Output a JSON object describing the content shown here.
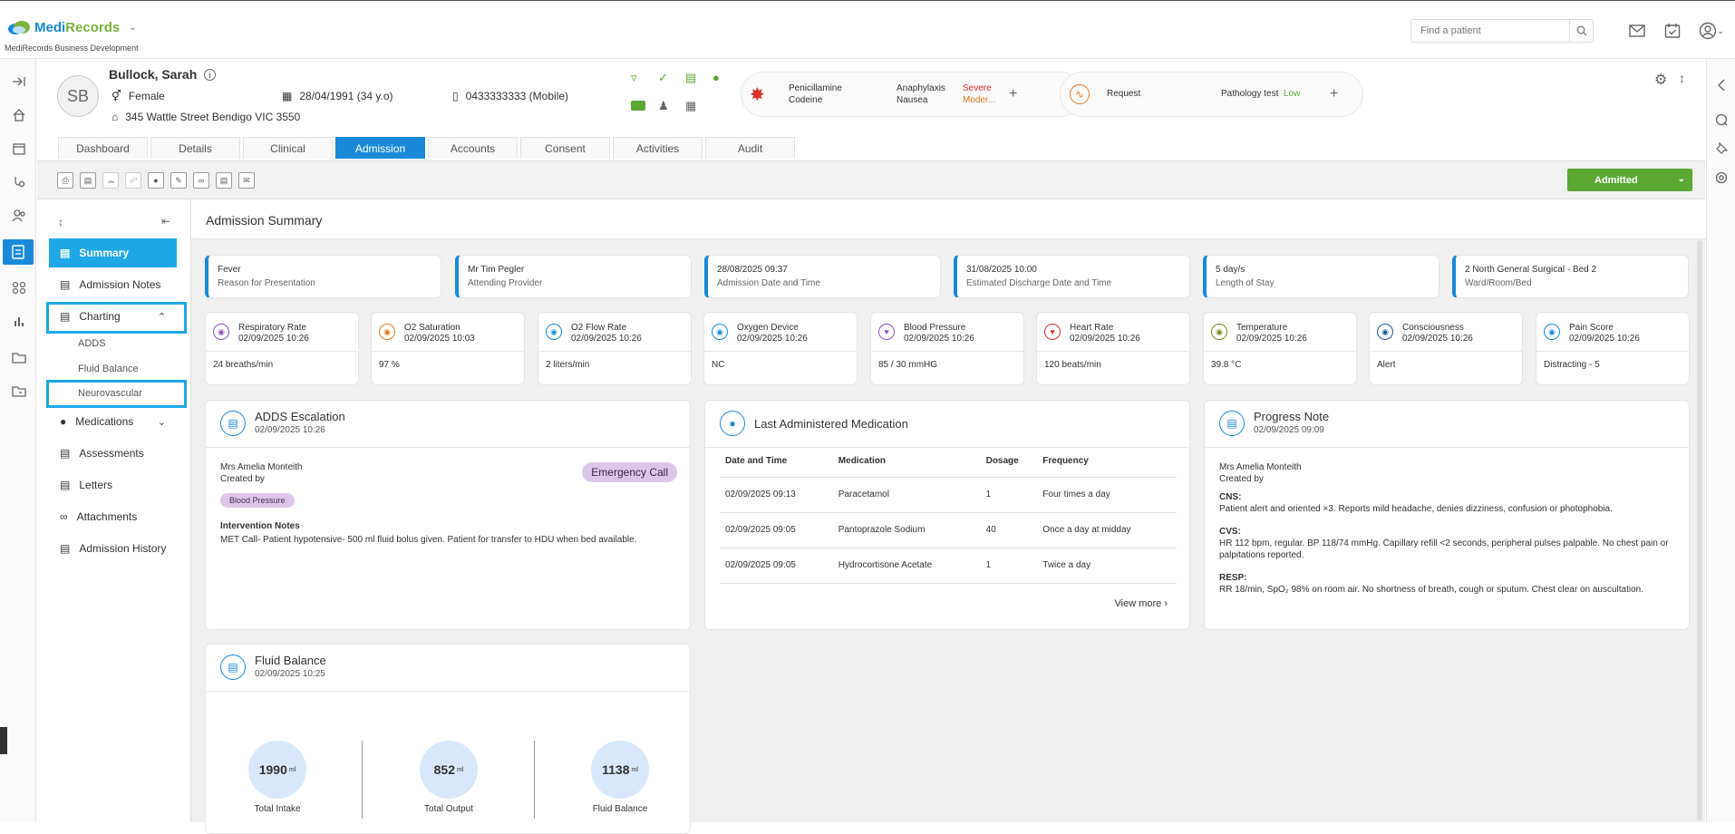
{
  "app": {
    "name_part1": "Medi",
    "name_part2": "Records",
    "subtitle": "MediRecords Business Development",
    "brand_color": "#1a8ad8",
    "accent_green": "#5aa832"
  },
  "search": {
    "placeholder": "Find a patient"
  },
  "patient": {
    "initials": "SB",
    "name": "Bullock, Sarah",
    "gender": "Female",
    "dob": "28/04/1991 (34 y.o)",
    "phone": "0433333333 (Mobile)",
    "address": "345 Wattle Street Bendigo VIC 3550"
  },
  "allergies": {
    "items": [
      "Penicillamine",
      "Codeine"
    ],
    "reactions": [
      "Anaphylaxis",
      "Nausea"
    ],
    "severity": [
      "Severe",
      "Moder..."
    ]
  },
  "request": {
    "label": "Request",
    "test": "Pathology test",
    "level": "Low"
  },
  "tabs": [
    "Dashboard",
    "Details",
    "Clinical",
    "Admission",
    "Accounts",
    "Consent",
    "Activities",
    "Audit"
  ],
  "status": {
    "label": "Admitted"
  },
  "sidenav": {
    "summary": "Summary",
    "admission_notes": "Admission Notes",
    "charting": "Charting",
    "adds": "ADDS",
    "fluid_balance": "Fluid Balance",
    "neurovascular": "Neurovascular",
    "medications": "Medications",
    "assessments": "Assessments",
    "letters": "Letters",
    "attachments": "Attachments",
    "admission_history": "Admission History"
  },
  "main": {
    "title": "Admission Summary"
  },
  "summary_cards": [
    {
      "value": "Fever",
      "label": "Reason for Presentation"
    },
    {
      "value": "Mr Tim Pegler",
      "label": "Attending Provider"
    },
    {
      "value": "28/08/2025 09:37",
      "label": "Admission Date and Time"
    },
    {
      "value": "31/08/2025 10:00",
      "label": "Estimated Discharge Date and Time"
    },
    {
      "value": "5 day/s",
      "label": "Length of Stay"
    },
    {
      "value": "2 North General Surgical - Bed 2",
      "label": "Ward/Room/Bed"
    }
  ],
  "vitals": [
    {
      "name": "Respiratory Rate",
      "time": "02/09/2025 10:26",
      "value": "24 breaths/min",
      "color": "#8a4fbd"
    },
    {
      "name": "O2 Saturation",
      "time": "02/09/2025 10:03",
      "value": "97 %",
      "color": "#e07a1f"
    },
    {
      "name": "O2 Flow Rate",
      "time": "02/09/2025 10:26",
      "value": "2 liters/min",
      "color": "#1a8ad8"
    },
    {
      "name": "Oxygen Device",
      "time": "02/09/2025 10:26",
      "value": "NC",
      "color": "#1a8ad8"
    },
    {
      "name": "Blood Pressure",
      "time": "02/09/2025 10:26",
      "value": "85 / 30 mmHG",
      "color": "#8a4fbd"
    },
    {
      "name": "Heart Rate",
      "time": "02/09/2025 10:26",
      "value": "120 beats/min",
      "color": "#d9302c"
    },
    {
      "name": "Temperature",
      "time": "02/09/2025 10:26",
      "value": "39.8 °C",
      "color": "#7a8a1a"
    },
    {
      "name": "Consciousness",
      "time": "02/09/2025 10:26",
      "value": "Alert",
      "color": "#1a5a9a"
    },
    {
      "name": "Pain Score",
      "time": "02/09/2025 10:26",
      "value": "Distracting - 5",
      "color": "#1a8ad8"
    }
  ],
  "adds": {
    "title": "ADDS Escalation",
    "time": "02/09/2025 10:26",
    "author": "Mrs Amelia Monteith",
    "created_by": "Created by",
    "badge": "Blood Pressure",
    "call": "Emergency Call",
    "notes_label": "Intervention Notes",
    "notes": "MET Call- Patient hypotensive- 500 ml fluid bolus given. Patient for transfer to HDU when bed available."
  },
  "medication": {
    "title": "Last Administered Medication",
    "headers": [
      "Date and Time",
      "Medication",
      "Dosage",
      "Frequency"
    ],
    "rows": [
      [
        "02/09/2025 09:13",
        "Paracetamol",
        "1",
        "Four times a day"
      ],
      [
        "02/09/2025 09:05",
        "Pantoprazole Sodium",
        "40",
        "Once a day at midday"
      ],
      [
        "02/09/2025 09:05",
        "Hydrocortisone Acetate",
        "1",
        "Twice a day"
      ]
    ],
    "view_more": "View more"
  },
  "progress": {
    "title": "Progress Note",
    "time": "02/09/2025 09:09",
    "author": "Mrs Amelia Monteith",
    "created_by": "Created by",
    "cns_label": "CNS:",
    "cns": "Patient alert and oriented ×3. Reports mild headache, denies dizziness, confusion or photophobia.",
    "cvs_label": "CVS:",
    "cvs": "HR 112 bpm, regular. BP 118/74 mmHg. Capillary refill <2 seconds, peripheral pulses palpable. No chest pain or palpitations reported.",
    "resp_label": "RESP:",
    "resp": "RR 18/min, SpO₂ 98% on room air. No shortness of breath, cough or sputum. Chest clear on auscultation."
  },
  "fluid": {
    "title": "Fluid Balance",
    "time": "02/09/2025 10:25",
    "unit": "ml",
    "intake": "1990",
    "intake_label": "Total Intake",
    "output": "852",
    "output_label": "Total Output",
    "balance": "1138",
    "balance_label": "Fluid Balance"
  }
}
